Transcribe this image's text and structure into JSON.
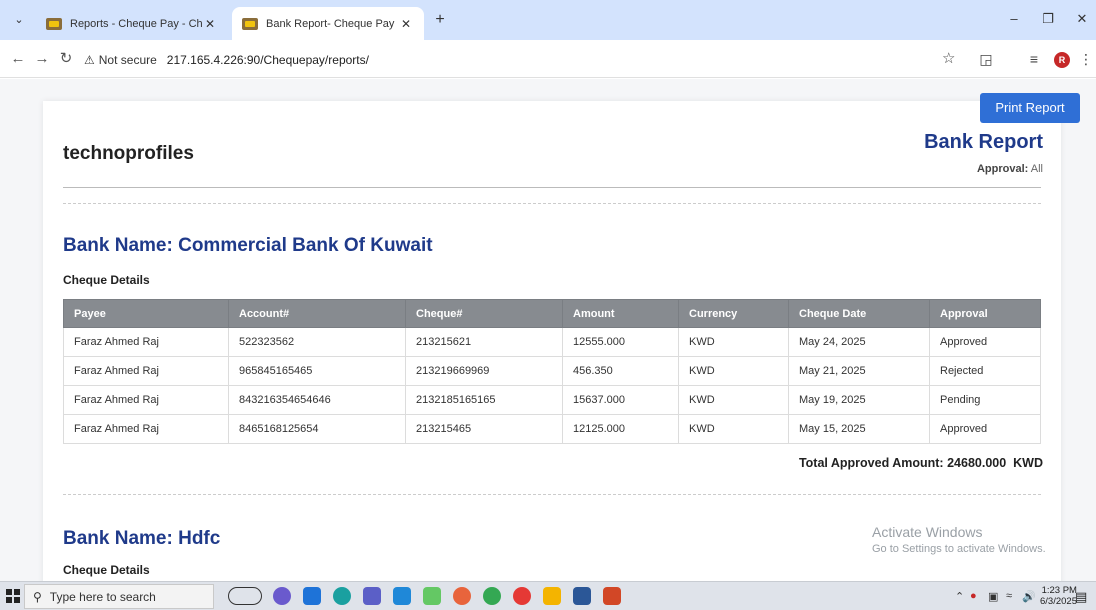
{
  "browser": {
    "tabs": [
      {
        "title": "Reports - Cheque Pay - Cheque"
      },
      {
        "title": "Bank Report- Cheque Pay - Che"
      }
    ],
    "security_label": "Not secure",
    "url": "217.165.4.226:90/Chequepay/reports/",
    "profile_initial": "R"
  },
  "page": {
    "print_button": "Print Report",
    "company": "technoprofiles",
    "report_title": "Bank Report",
    "approval_label": "Approval:",
    "approval_value": "All",
    "banks": [
      {
        "name": "Bank Name: Commercial Bank Of Kuwait",
        "section_label": "Cheque Details",
        "table": {
          "headers": [
            "Payee",
            "Account#",
            "Cheque#",
            "Amount",
            "Currency",
            "Cheque Date",
            "Approval"
          ],
          "rows": [
            [
              "Faraz Ahmed Raj",
              "522323562",
              "213215621",
              "12555.000",
              "KWD",
              "May 24, 2025",
              "Approved"
            ],
            [
              "Faraz Ahmed Raj",
              "965845165465",
              "213219669969",
              "456.350",
              "KWD",
              "May 21, 2025",
              "Rejected"
            ],
            [
              "Faraz Ahmed Raj",
              "843216354654646",
              "2132185165165",
              "15637.000",
              "KWD",
              "May 19, 2025",
              "Pending"
            ],
            [
              "Faraz Ahmed Raj",
              "8465168125654",
              "213215465",
              "12125.000",
              "KWD",
              "May 15, 2025",
              "Approved"
            ]
          ]
        },
        "total_label": "Total Approved Amount:",
        "total_value": "24680.000",
        "total_currency": "KWD"
      },
      {
        "name": "Bank Name: Hdfc",
        "section_label": "Cheque Details"
      }
    ]
  },
  "watermark": {
    "title": "Activate Windows",
    "subtitle": "Go to Settings to activate Windows."
  },
  "taskbar": {
    "search_placeholder": "Type here to search",
    "time": "1:23 PM",
    "date": "6/3/2025"
  }
}
